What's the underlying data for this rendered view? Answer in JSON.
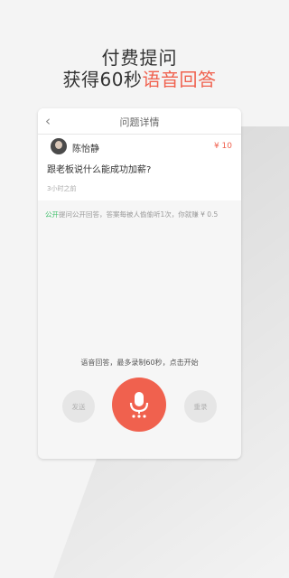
{
  "promo": {
    "line1": "付费提问",
    "line2_prefix": "获得60秒",
    "line2_highlight": "语音回答"
  },
  "nav": {
    "back_icon": "chevron-left-icon",
    "title": "问题详情"
  },
  "question": {
    "user_name": "陈怡静",
    "price": "¥ 10",
    "text": "跟老板说什么能成功加薪?",
    "time": "3小时之前"
  },
  "notice": {
    "tag": "公开",
    "text": "提问公开回答，答案每被人偷偷听1次，你就赚 ¥ 0.5"
  },
  "recorder": {
    "hint": "语音回答，最多录制60秒，点击开始",
    "send_label": "发送",
    "redo_label": "重录",
    "mic_icon": "microphone-icon"
  },
  "colors": {
    "accent": "#f0614e",
    "green": "#3fbf6a"
  }
}
